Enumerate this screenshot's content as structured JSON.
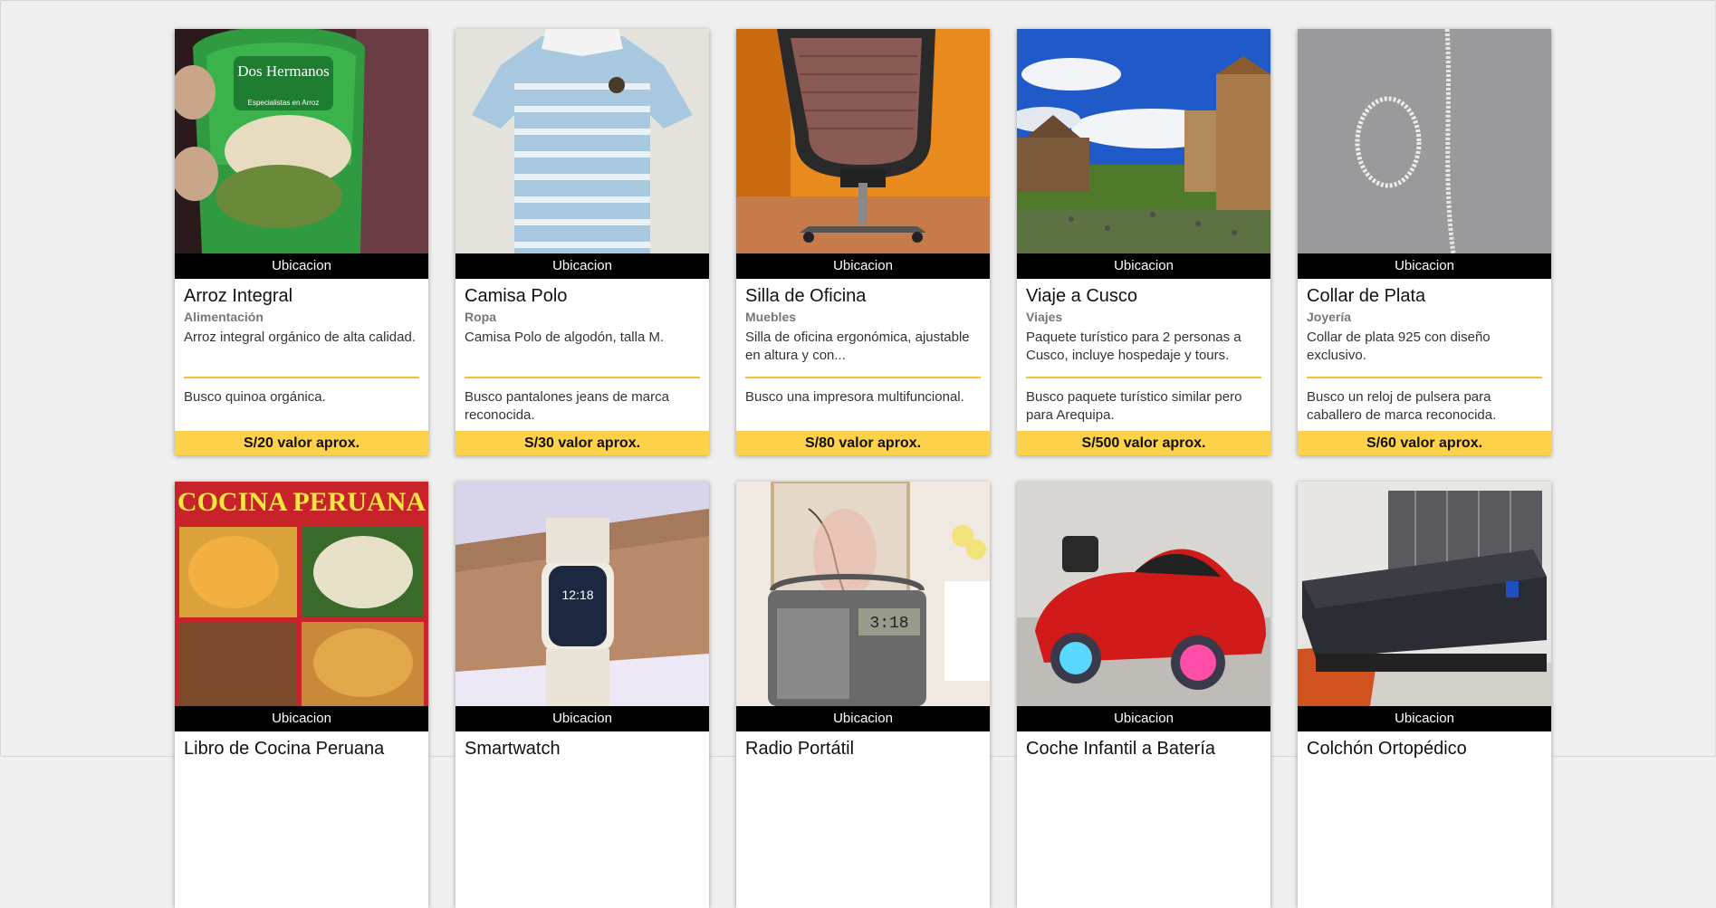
{
  "labels": {
    "location": "Ubicacion"
  },
  "products": [
    {
      "title": "Arroz Integral",
      "category": "Alimentación",
      "description": "Arroz integral orgánico de alta calidad.",
      "wants": "Busco quinoa orgánica.",
      "price": "S/20 valor aprox."
    },
    {
      "title": "Camisa Polo",
      "category": "Ropa",
      "description": "Camisa Polo de algodón, talla M.",
      "wants": "Busco pantalones jeans de marca reconocida.",
      "price": "S/30 valor aprox."
    },
    {
      "title": "Silla de Oficina",
      "category": "Muebles",
      "description": "Silla de oficina ergonómica, ajustable en altura y con...",
      "wants": "Busco una impresora multifuncional.",
      "price": "S/80 valor aprox."
    },
    {
      "title": "Viaje a Cusco",
      "category": "Viajes",
      "description": "Paquete turístico para 2 personas a Cusco, incluye hospedaje y tours.",
      "wants": "Busco paquete turístico similar pero para Arequipa.",
      "price": "S/500 valor aprox."
    },
    {
      "title": "Collar de Plata",
      "category": "Joyería",
      "description": "Collar de plata 925 con diseño exclusivo.",
      "wants": "Busco un reloj de pulsera para caballero de marca reconocida.",
      "price": "S/60 valor aprox."
    },
    {
      "title": "Libro de Cocina Peruana",
      "image_text": "COCINA PERUANA"
    },
    {
      "title": "Smartwatch",
      "image_text": "12:18"
    },
    {
      "title": "Radio Portátil",
      "image_text": "3:18"
    },
    {
      "title": "Coche Infantil a Batería"
    },
    {
      "title": "Colchón Ortopédico"
    }
  ],
  "image_texts": {
    "rice_bag_brand": "Dos Hermanos",
    "rice_bag_sub": "Especialistas en Arroz"
  },
  "colors": {
    "accent": "#fdd14a",
    "separator": "#f5c034",
    "location_bar": "#000000"
  }
}
